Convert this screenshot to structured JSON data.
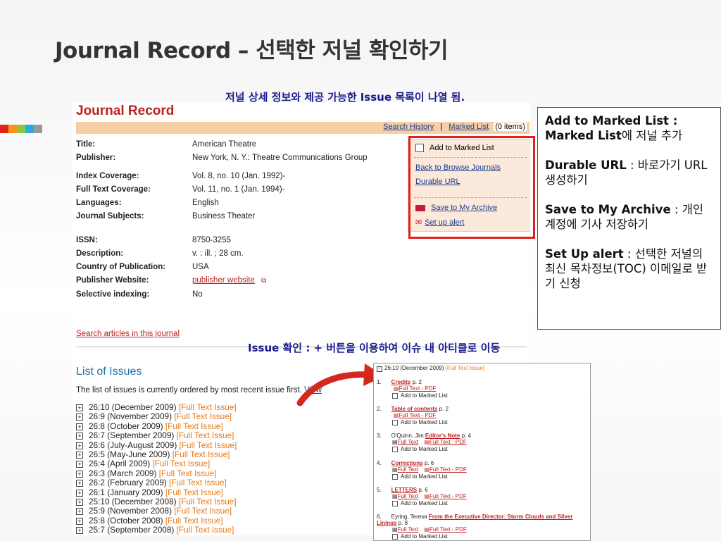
{
  "slide": {
    "title": "Journal Record – 선택한 저널 확인하기",
    "top_caption": "저널 상세 정보와 제공 가능한 Issue 목록이 나열 됨.",
    "issue_caption": "Issue 확인 : + 버튼을 이용하여 이슈 내 아티클로 이동",
    "accent_colors": [
      "#e2231a",
      "#f7941d",
      "#8dc63f",
      "#29abe2",
      "#999999"
    ]
  },
  "record": {
    "heading": "Journal Record",
    "toolbar": {
      "history": "Search History",
      "sep": "|",
      "marked": "Marked List",
      "count": "(0 items)"
    },
    "fields": [
      {
        "k": "Title:",
        "v": "American Theatre"
      },
      {
        "k": "Publisher:",
        "v": "New York, N. Y.: Theatre Communications Group"
      },
      {
        "k": "Index Coverage:",
        "v": "Vol. 8, no. 10 (Jan. 1992)-"
      },
      {
        "k": "Full Text Coverage:",
        "v": "Vol. 11, no. 1 (Jan. 1994)-"
      },
      {
        "k": "Languages:",
        "v": "English"
      },
      {
        "k": "Journal Subjects:",
        "v": "Business Theater"
      },
      {
        "k": "ISSN:",
        "v": "8750-3255"
      },
      {
        "k": "Description:",
        "v": "v. : ill. ; 28 cm."
      },
      {
        "k": "Country of Publication:",
        "v": "USA"
      },
      {
        "k": "Publisher Website:",
        "v": "publisher website"
      },
      {
        "k": "Selective indexing:",
        "v": "No"
      }
    ],
    "search_link": "Search articles in this journal",
    "sidebox": {
      "add_marked": "Add to Marked List",
      "back_browse": "Back to Browse Journals",
      "durable": "Durable URL",
      "save": "Save to My Archive",
      "alert": "Set up alert"
    },
    "list_title": "List of Issues",
    "list_note": "The list of issues is currently ordered by most recent issue first.",
    "list_note_link": "View",
    "full_text_issue": "[Full Text Issue]",
    "issues": [
      "26:10 (December 2009)",
      "26:9 (November 2009)",
      "26:8 (October 2009)",
      "26:7 (September 2009)",
      "26:6 (July-August 2009)",
      "26:5 (May-June 2009)",
      "26:4 (April 2009)",
      "26:3 (March 2009)",
      "26:2 (February 2009)",
      "26:1 (January 2009)",
      "25:10 (December 2008)",
      "25:9 (November 2008)",
      "25:8 (October 2008)",
      "25:7 (September 2008)"
    ]
  },
  "explain": {
    "b1_title": "Add to Marked List :",
    "b1_bold": "Marked List",
    "b1_text": "에 저널 추가",
    "b2_title": "Durable URL",
    "b2_text": " : 바로가기 URL 생성하기",
    "b3_title": "Save to My Archive",
    "b3_text": " : 개인 계정에 기사 저장하기",
    "b4_title": "Set Up alert",
    "b4_text": " : 선택한 저널의 최신 목차정보(TOC) 이메일로 받기 신청"
  },
  "inset": {
    "issue": "26:10 (December 2009)",
    "full_text_issue": "[Full Text Issue]",
    "full_text": "Full Text",
    "full_text_pdf": "Full Text - PDF",
    "add_marked": "Add to Marked List",
    "articles": [
      {
        "num": "1.",
        "author": "",
        "title": "Credits",
        "page": "p. 2",
        "html": false
      },
      {
        "num": "2.",
        "author": "",
        "title": "Table of contents",
        "page": "p. 2",
        "html": false
      },
      {
        "num": "3.",
        "author": "O'Quinn, Jim",
        "title": "Editor's Note",
        "page": "p. 4",
        "html": true
      },
      {
        "num": "4.",
        "author": "",
        "title": "Corrections",
        "page": "p. 6",
        "html": true
      },
      {
        "num": "5.",
        "author": "",
        "title": "LETTERS",
        "page": "p. 6",
        "html": true
      },
      {
        "num": "6.",
        "author": "Eyring, Teresa",
        "title": "From the Executive Director: Storm Clouds and Silver Linings",
        "page": "p. 8",
        "html": true
      }
    ]
  }
}
